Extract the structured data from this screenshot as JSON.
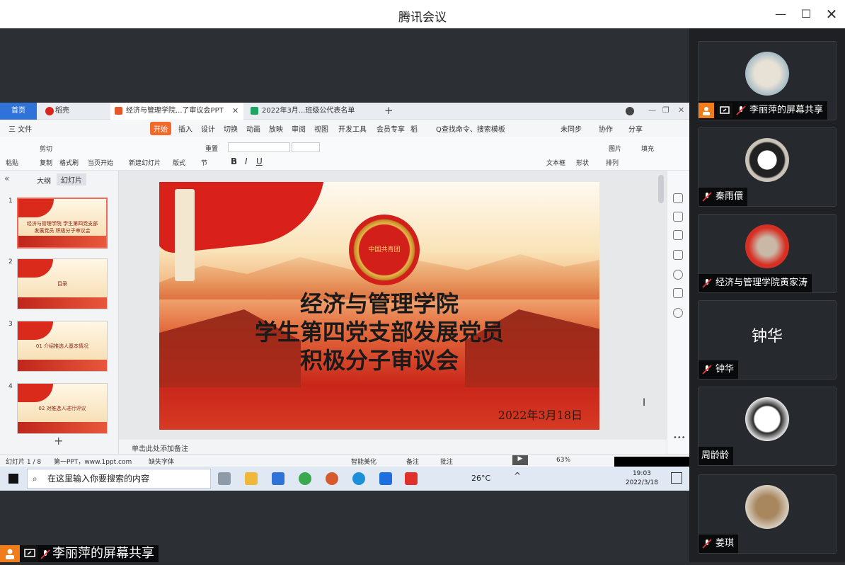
{
  "window": {
    "title": "腾讯会议"
  },
  "participants": [
    {
      "name": "李丽萍的屏幕共享",
      "kind": "avatar"
    },
    {
      "name": "秦雨儇",
      "kind": "avatar"
    },
    {
      "name": "经济与管理学院黄家涛",
      "kind": "avatar"
    },
    {
      "name": "钟华",
      "kind": "text",
      "big": "钟华"
    },
    {
      "name": "周龄龄",
      "kind": "avatar"
    },
    {
      "name": "姜琪",
      "kind": "avatar"
    }
  ],
  "share_label": "李丽萍的屏幕共享",
  "wps": {
    "tabs": [
      "首页",
      "稻壳",
      "经济与管理学院...了审议会PPT",
      "2022年3月...班级公代表名单"
    ],
    "menu": [
      "三 文件",
      "开始",
      "插入",
      "设计",
      "切换",
      "动画",
      "放映",
      "审阅",
      "视图",
      "开发工具",
      "会员专享",
      "稻"
    ],
    "search_cmd": "Q查找命令、搜索模板",
    "menu_right": [
      "未同步",
      "协作",
      "分享"
    ],
    "ribbon": [
      "剪切",
      "粘贴",
      "复制",
      "格式刷",
      "当页开始",
      "新建幻灯片",
      "版式",
      "节",
      "重置",
      "文本框",
      "形状",
      "排列",
      "图片",
      "填充"
    ],
    "panel_tabs": [
      "大纲",
      "幻灯片"
    ],
    "thumbs": [
      {
        "num": "1",
        "text": "经济与管理学院 学生第四党支部发展党员 积极分子审议会"
      },
      {
        "num": "2",
        "text": "目录"
      },
      {
        "num": "3",
        "text": "01 介绍推选人基本情况"
      },
      {
        "num": "4",
        "text": "02 对推选人进行评议"
      }
    ],
    "slide": {
      "title_lines": [
        "经济与管理学院",
        "学生第四党支部发展党员",
        "积极分子审议会"
      ],
      "emblem_text": "中国共青团",
      "date": "2022年3月18日"
    },
    "notes": "单击此处添加备注",
    "status": {
      "slide_no": "幻灯片 1 / 8",
      "theme": "第一PPT，www.1ppt.com",
      "font_missing": "缺失字体",
      "beautify": "智能美化",
      "comments": "备注",
      "annotate": "批注",
      "zoom": "63%"
    }
  },
  "taskbar": {
    "search_placeholder": "在这里输入你要搜索的内容",
    "temp": "26°C",
    "time": "19:03",
    "date": "2022/3/18"
  }
}
